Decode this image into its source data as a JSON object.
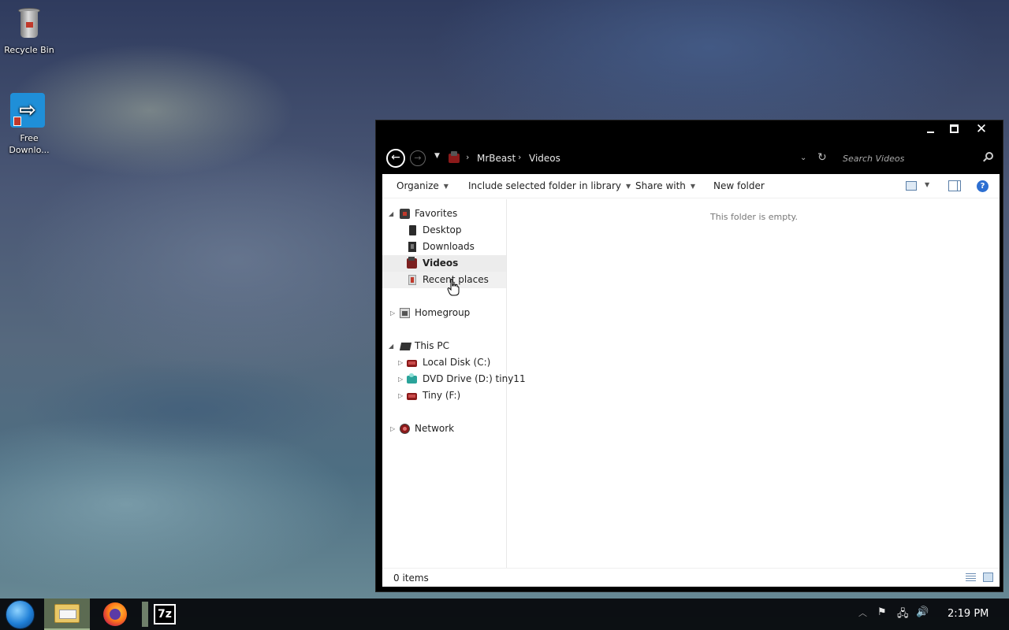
{
  "desktop": {
    "icons": [
      {
        "label": "Recycle Bin",
        "icon": "recycle-bin-icon"
      },
      {
        "label": "Free\nDownlo...",
        "icon": "free-downloader-icon"
      }
    ]
  },
  "window": {
    "address": {
      "crumbs": [
        "MrBeast",
        "Videos"
      ],
      "search_placeholder": "Search Videos"
    },
    "toolbar": {
      "organize": "Organize",
      "include_library": "Include selected folder in library",
      "share_with": "Share with",
      "new_folder": "New folder"
    },
    "navpane": {
      "favorites": "Favorites",
      "desktop": "Desktop",
      "downloads": "Downloads",
      "videos": "Videos",
      "recent_places": "Recent places",
      "homegroup": "Homegroup",
      "this_pc": "This PC",
      "local_disk": "Local Disk (C:)",
      "dvd_drive": "DVD Drive (D:) tiny11",
      "tiny": "Tiny (F:)",
      "network": "Network"
    },
    "content": {
      "empty_message": "This folder is empty."
    },
    "status": {
      "items": "0 items"
    }
  },
  "taskbar": {
    "apps": [
      "start-orb",
      "file-explorer",
      "firefox",
      "7-zip"
    ],
    "seven_zip_label": "7z",
    "clock": "2:19 PM"
  },
  "colors": {
    "window_chrome": "#000000",
    "selected_nav": "#ececec",
    "taskbar_bg": "#080a0e"
  }
}
